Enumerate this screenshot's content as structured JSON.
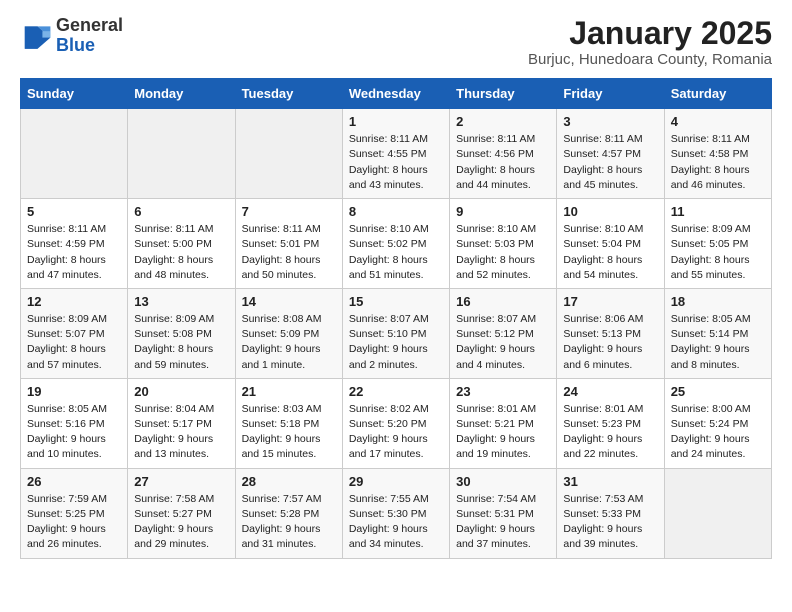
{
  "header": {
    "logo_general": "General",
    "logo_blue": "Blue",
    "title": "January 2025",
    "subtitle": "Burjuc, Hunedoara County, Romania"
  },
  "calendar": {
    "days_of_week": [
      "Sunday",
      "Monday",
      "Tuesday",
      "Wednesday",
      "Thursday",
      "Friday",
      "Saturday"
    ],
    "weeks": [
      [
        {
          "day": "",
          "info": ""
        },
        {
          "day": "",
          "info": ""
        },
        {
          "day": "",
          "info": ""
        },
        {
          "day": "1",
          "info": "Sunrise: 8:11 AM\nSunset: 4:55 PM\nDaylight: 8 hours and 43 minutes."
        },
        {
          "day": "2",
          "info": "Sunrise: 8:11 AM\nSunset: 4:56 PM\nDaylight: 8 hours and 44 minutes."
        },
        {
          "day": "3",
          "info": "Sunrise: 8:11 AM\nSunset: 4:57 PM\nDaylight: 8 hours and 45 minutes."
        },
        {
          "day": "4",
          "info": "Sunrise: 8:11 AM\nSunset: 4:58 PM\nDaylight: 8 hours and 46 minutes."
        }
      ],
      [
        {
          "day": "5",
          "info": "Sunrise: 8:11 AM\nSunset: 4:59 PM\nDaylight: 8 hours and 47 minutes."
        },
        {
          "day": "6",
          "info": "Sunrise: 8:11 AM\nSunset: 5:00 PM\nDaylight: 8 hours and 48 minutes."
        },
        {
          "day": "7",
          "info": "Sunrise: 8:11 AM\nSunset: 5:01 PM\nDaylight: 8 hours and 50 minutes."
        },
        {
          "day": "8",
          "info": "Sunrise: 8:10 AM\nSunset: 5:02 PM\nDaylight: 8 hours and 51 minutes."
        },
        {
          "day": "9",
          "info": "Sunrise: 8:10 AM\nSunset: 5:03 PM\nDaylight: 8 hours and 52 minutes."
        },
        {
          "day": "10",
          "info": "Sunrise: 8:10 AM\nSunset: 5:04 PM\nDaylight: 8 hours and 54 minutes."
        },
        {
          "day": "11",
          "info": "Sunrise: 8:09 AM\nSunset: 5:05 PM\nDaylight: 8 hours and 55 minutes."
        }
      ],
      [
        {
          "day": "12",
          "info": "Sunrise: 8:09 AM\nSunset: 5:07 PM\nDaylight: 8 hours and 57 minutes."
        },
        {
          "day": "13",
          "info": "Sunrise: 8:09 AM\nSunset: 5:08 PM\nDaylight: 8 hours and 59 minutes."
        },
        {
          "day": "14",
          "info": "Sunrise: 8:08 AM\nSunset: 5:09 PM\nDaylight: 9 hours and 1 minute."
        },
        {
          "day": "15",
          "info": "Sunrise: 8:07 AM\nSunset: 5:10 PM\nDaylight: 9 hours and 2 minutes."
        },
        {
          "day": "16",
          "info": "Sunrise: 8:07 AM\nSunset: 5:12 PM\nDaylight: 9 hours and 4 minutes."
        },
        {
          "day": "17",
          "info": "Sunrise: 8:06 AM\nSunset: 5:13 PM\nDaylight: 9 hours and 6 minutes."
        },
        {
          "day": "18",
          "info": "Sunrise: 8:05 AM\nSunset: 5:14 PM\nDaylight: 9 hours and 8 minutes."
        }
      ],
      [
        {
          "day": "19",
          "info": "Sunrise: 8:05 AM\nSunset: 5:16 PM\nDaylight: 9 hours and 10 minutes."
        },
        {
          "day": "20",
          "info": "Sunrise: 8:04 AM\nSunset: 5:17 PM\nDaylight: 9 hours and 13 minutes."
        },
        {
          "day": "21",
          "info": "Sunrise: 8:03 AM\nSunset: 5:18 PM\nDaylight: 9 hours and 15 minutes."
        },
        {
          "day": "22",
          "info": "Sunrise: 8:02 AM\nSunset: 5:20 PM\nDaylight: 9 hours and 17 minutes."
        },
        {
          "day": "23",
          "info": "Sunrise: 8:01 AM\nSunset: 5:21 PM\nDaylight: 9 hours and 19 minutes."
        },
        {
          "day": "24",
          "info": "Sunrise: 8:01 AM\nSunset: 5:23 PM\nDaylight: 9 hours and 22 minutes."
        },
        {
          "day": "25",
          "info": "Sunrise: 8:00 AM\nSunset: 5:24 PM\nDaylight: 9 hours and 24 minutes."
        }
      ],
      [
        {
          "day": "26",
          "info": "Sunrise: 7:59 AM\nSunset: 5:25 PM\nDaylight: 9 hours and 26 minutes."
        },
        {
          "day": "27",
          "info": "Sunrise: 7:58 AM\nSunset: 5:27 PM\nDaylight: 9 hours and 29 minutes."
        },
        {
          "day": "28",
          "info": "Sunrise: 7:57 AM\nSunset: 5:28 PM\nDaylight: 9 hours and 31 minutes."
        },
        {
          "day": "29",
          "info": "Sunrise: 7:55 AM\nSunset: 5:30 PM\nDaylight: 9 hours and 34 minutes."
        },
        {
          "day": "30",
          "info": "Sunrise: 7:54 AM\nSunset: 5:31 PM\nDaylight: 9 hours and 37 minutes."
        },
        {
          "day": "31",
          "info": "Sunrise: 7:53 AM\nSunset: 5:33 PM\nDaylight: 9 hours and 39 minutes."
        },
        {
          "day": "",
          "info": ""
        }
      ]
    ]
  }
}
